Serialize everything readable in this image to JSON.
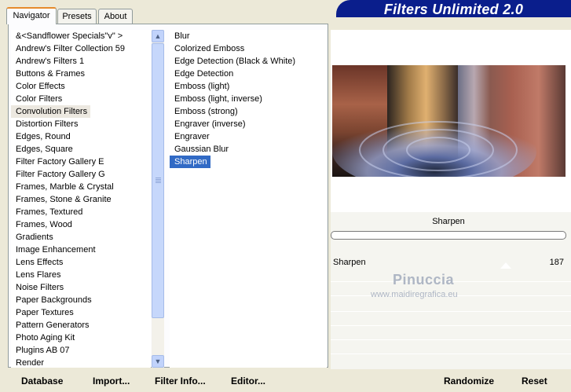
{
  "tabs": [
    {
      "label": "Navigator"
    },
    {
      "label": "Presets"
    },
    {
      "label": "About"
    }
  ],
  "banner": {
    "title": "Filters Unlimited 2.0"
  },
  "categories": [
    "&<Sandflower Specials\"v\" >",
    "Andrew's Filter Collection 59",
    "Andrew's Filters 1",
    "Buttons & Frames",
    "Color Effects",
    "Color Filters",
    "Convolution Filters",
    "Distortion Filters",
    "Edges, Round",
    "Edges, Square",
    "Filter Factory Gallery E",
    "Filter Factory Gallery G",
    "Frames, Marble & Crystal",
    "Frames, Stone & Granite",
    "Frames, Textured",
    "Frames, Wood",
    "Gradients",
    "Image Enhancement",
    "Lens Effects",
    "Lens Flares",
    "Noise Filters",
    "Paper Backgrounds",
    "Paper Textures",
    "Pattern Generators",
    "Photo Aging Kit",
    "Plugins AB 07",
    "Render"
  ],
  "selected_category": "Convolution Filters",
  "filters": [
    "Blur",
    "Colorized Emboss",
    "Edge Detection (Black & White)",
    "Edge Detection",
    "Emboss (light)",
    "Emboss (light, inverse)",
    "Emboss (strong)",
    "Engraver (inverse)",
    "Engraver",
    "Gaussian Blur",
    "Sharpen"
  ],
  "selected_filter": "Sharpen",
  "filter_title": "Sharpen",
  "parameters": [
    {
      "label": "Sharpen",
      "value": "187",
      "level": 0.733
    }
  ],
  "watermark": {
    "name": "Pinuccia",
    "url": "www.maidiregrafica.eu"
  },
  "buttons": {
    "database": "Database",
    "import": "Import...",
    "filter_info": "Filter Info...",
    "editor": "Editor...",
    "randomize": "Randomize",
    "reset": "Reset"
  },
  "colors": {
    "banner": "#0a1e8c",
    "selection": "#316ac5",
    "tab_accent": "#e68b2c"
  },
  "icons": {
    "scroll_up": "chevron-up-icon",
    "scroll_down": "chevron-down-icon"
  }
}
